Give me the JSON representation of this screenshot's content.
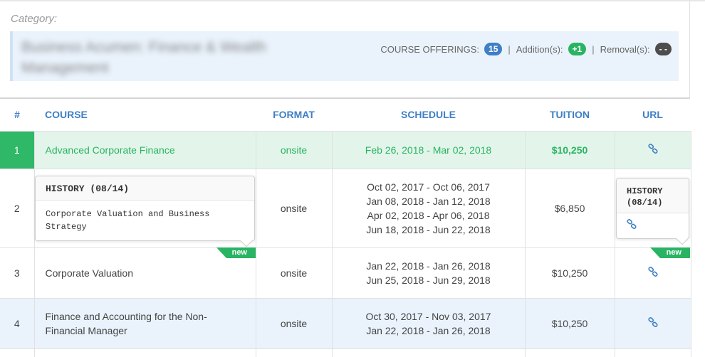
{
  "category": {
    "label": "Category:",
    "name": "Business Acumen: Finance & Wealth Management"
  },
  "summary": {
    "offerings_label": "COURSE OFFERINGS:",
    "offerings_count": "15",
    "sep": "|",
    "additions_label": "Addition(s):",
    "additions_count": "+1",
    "removals_label": "Removal(s):",
    "removals_count": "- -"
  },
  "table": {
    "headers": {
      "num": "#",
      "course": "COURSE",
      "format": "FORMAT",
      "schedule": "SCHEDULE",
      "tuition": "TUITION",
      "url": "URL"
    },
    "rows": [
      {
        "num": "1",
        "course": "Advanced Corporate Finance",
        "format": "onsite",
        "schedule": [
          "Feb 26, 2018 - Mar 02, 2018"
        ],
        "tuition": "$10,250"
      },
      {
        "num": "2",
        "course": "Corporate Valuation and Business Strategy",
        "format": "onsite",
        "schedule": [
          "Oct 02, 2017 - Oct 06, 2017",
          "Jan 08, 2018 - Jan 12, 2018",
          "Apr 02, 2018 - Apr 06, 2018",
          "Jun 18, 2018 - Jun 22, 2018"
        ],
        "tuition": "$6,850"
      },
      {
        "num": "3",
        "course": "Corporate Valuation",
        "format": "onsite",
        "schedule": [
          "Jan 22, 2018 - Jan 26, 2018",
          "Jun 25, 2018 - Jun 29, 2018"
        ],
        "tuition": "$10,250"
      },
      {
        "num": "4",
        "course": "Finance and Accounting for the Non-Financial Manager",
        "format": "onsite",
        "schedule": [
          "Oct 30, 2017 - Nov 03, 2017",
          "Jan 22, 2018 - Jan 26, 2018"
        ],
        "tuition": "$10,250"
      }
    ]
  },
  "tooltips": {
    "course": {
      "title": "HISTORY (08/14)",
      "body": "Corporate Valuation and Business Strategy"
    },
    "url": {
      "title": "HISTORY (08/14)"
    }
  },
  "ribbons": {
    "new_label": "new"
  },
  "icons": {
    "url": "link-icon"
  },
  "colors": {
    "accent_blue": "#3f7fc5",
    "accent_green": "#28b463",
    "row_green": "#e3f5ea",
    "row_blue": "#eaf3fc"
  }
}
